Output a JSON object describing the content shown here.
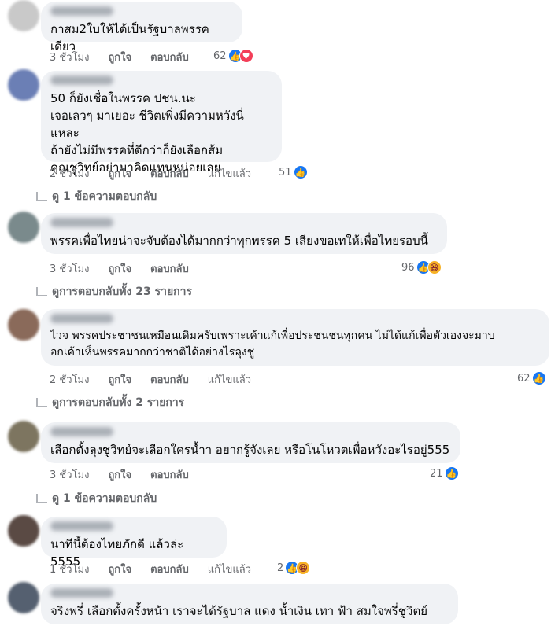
{
  "actions": {
    "like": "ถูกใจ",
    "reply": "ตอบกลับ",
    "edited": "แก้ไขแล้ว"
  },
  "comments": [
    {
      "text": "กาสม2ใบให้ได้เป็นรัฐบาลพรรคเดียว",
      "time": "3 ชั่วโมง",
      "count": "62",
      "reactions": [
        "like-icon",
        "heart-icon"
      ],
      "avatar": "#c9c9c9"
    },
    {
      "text": "50 ก็ยังเชื่อในพรรค ปชน.นะ\nเจอเลวๆ มาเยอะ ชีวิตเพิ่งมีความหวังนี่แหละ\nถ้ายังไม่มีพรรคที่ดีกว่าก็ยังเลือกส้ม\nคุณชูวิทย์อย่ามาคิดแทนหน่อยเลย",
      "time": "2 ชั่วโมง",
      "count": "51",
      "edited": true,
      "reactions": [
        "like-icon"
      ],
      "replies": "ดู 1 ข้อความตอบกลับ",
      "avatar": "#6b7fb5"
    },
    {
      "text": "พรรคเพื่อไทยน่าจะจับต้องได้มากกว่าทุกพรรค 5 เสียงขอเทให้เพื่อไทยรอบนี้",
      "time": "3 ชั่วโมง",
      "count": "96",
      "reactions": [
        "like-icon",
        "haha-icon"
      ],
      "replies": "ดูการตอบกลับทั้ง 23 รายการ",
      "avatar": "#7a8a8c"
    },
    {
      "text": "ไวจ พรรคประชาชนเหมือนเดิมครับเพราะเค้าแก้เพื่อประชนชนทุกคน ไม่ได้แก้เพื่อตัวเองจะมาบ\nอกเค้าเห็นพรรคมากกว่าชาติได้อย่างไรลุงชู",
      "time": "2 ชั่วโมง",
      "count": "62",
      "edited": true,
      "reactions": [
        "like-icon"
      ],
      "replies": "ดูการตอบกลับทั้ง 2 รายการ",
      "avatar": "#8a6a5a"
    },
    {
      "text": "เลือกตั้งลุงชูวิทย์จะเลือกใครน้ำา อยากรู้จังเลย หรือโนโหวตเพื่อหวังอะไรอยู่555",
      "time": "3 ชั่วโมง",
      "count": "21",
      "reactions": [
        "like-icon"
      ],
      "replies": "ดู 1 ข้อความตอบกลับ",
      "avatar": "#7d7560"
    },
    {
      "text": "นาทีนี้ต้องไทยภักดี แล้วล่ะ 5555",
      "time": "1 ชั่วโมง",
      "count": "2",
      "edited": true,
      "reactions": [
        "like-icon",
        "haha-icon"
      ],
      "avatar": "#5a4a44"
    },
    {
      "text": "จริงพรี่ เลือกตั้งครั้งหน้า เราจะได้รัฐบาล แดง น้ำเงิน เทา ฟ้า สมใจพรี่ชูวิตย์",
      "avatar": "#556070"
    }
  ]
}
